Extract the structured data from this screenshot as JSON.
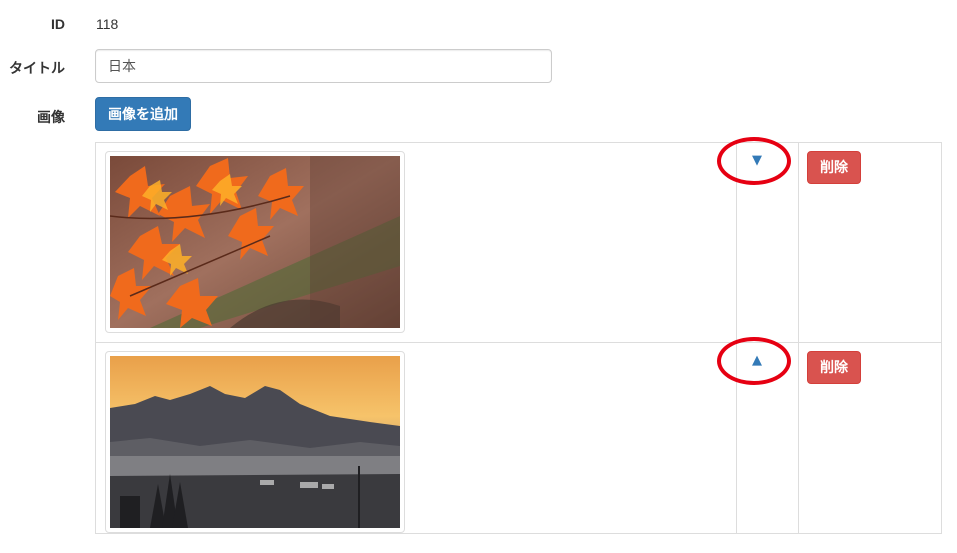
{
  "form": {
    "id_label": "ID",
    "id_value": "118",
    "title_label": "タイトル",
    "title_value": "日本",
    "image_label": "画像",
    "add_image_label": "画像を追加"
  },
  "images": [
    {
      "thumbnail_icon": "autumn-maple-photo",
      "move_arrow": "▼",
      "move_icon": "arrow-down-icon",
      "delete_label": "削除"
    },
    {
      "thumbnail_icon": "mountain-sunrise-photo",
      "move_arrow": "▲",
      "move_icon": "arrow-up-icon",
      "delete_label": "削除"
    }
  ],
  "colors": {
    "primary": "#337ab7",
    "danger": "#d9534f",
    "annotation": "#e60012",
    "border": "#dddddd"
  }
}
